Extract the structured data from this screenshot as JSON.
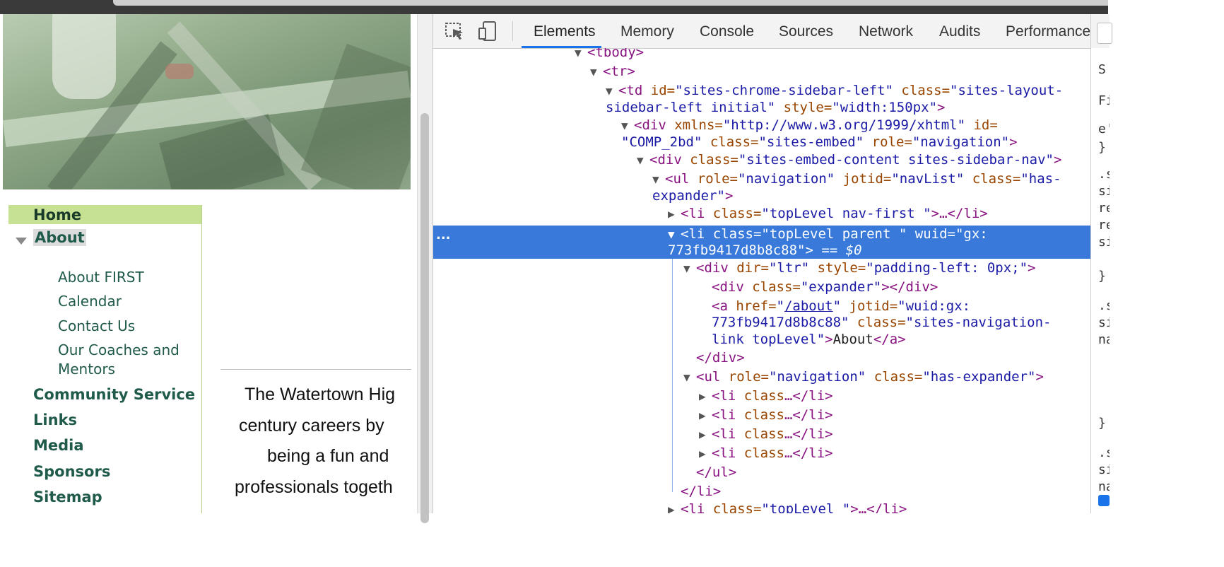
{
  "site": {
    "nav": {
      "home": "Home",
      "about": "About",
      "about_children": [
        "About FIRST",
        "Calendar",
        "Contact Us",
        "Our Coaches and",
        "Mentors"
      ],
      "others": [
        "Community Service",
        "Links",
        "Media",
        "Sponsors",
        "Sitemap"
      ]
    },
    "content_lines": [
      "The Watertown Hig",
      "century careers by",
      "being a fun and",
      "professionals togeth"
    ]
  },
  "devtools": {
    "tabs": [
      "Elements",
      "Memory",
      "Console",
      "Sources",
      "Network",
      "Audits",
      "Performance"
    ],
    "active_tab": "Elements",
    "selected_dots": "...",
    "tree": {
      "l1": "<tbody>",
      "l2": "<tr>",
      "l3a_tag": "<td",
      "l3a_attr1": " id=",
      "l3a_val1": "\"sites-chrome-sidebar-left\"",
      "l3a_attr2": " class=",
      "l3a_val2": "\"sites-layout-",
      "l3b_val": "sidebar-left initial\"",
      "l3b_attr": " style=",
      "l3b_val2": "\"width:150px\"",
      "l3b_end": ">",
      "l4a_tag": "<div",
      "l4a_attr1": " xmlns=",
      "l4a_val1": "\"http://www.w3.org/1999/xhtml\"",
      "l4a_attr2": " id=",
      "l4b_val1": "\"COMP_2bd\"",
      "l4b_attr1": " class=",
      "l4b_val2": "\"sites-embed\"",
      "l4b_attr2": " role=",
      "l4b_val3": "\"navigation\"",
      "l4b_end": ">",
      "l5_tag": "<div",
      "l5_attr": " class=",
      "l5_val": "\"sites-embed-content sites-sidebar-nav\"",
      "l5_end": ">",
      "l6a_tag": "<ul",
      "l6a_attr1": " role=",
      "l6a_val1": "\"navigation\"",
      "l6a_attr2": " jotid=",
      "l6a_val2": "\"navList\"",
      "l6a_attr3": " class=",
      "l6a_val3": "\"has-",
      "l6b_val": "expander\"",
      "l6b_end": ">",
      "l7_tag": "<li",
      "l7_attr": " class=",
      "l7_val": "\"topLevel nav-first \"",
      "l7_end": ">…</li>",
      "sel1_tag": "<li",
      "sel1_attr1": " class=",
      "sel1_val1": "\"topLevel parent \"",
      "sel1_attr2": " wuid=",
      "sel1_val2": "\"gx:",
      "sel2_val": "773fb9417d8b8c88\"",
      "sel2_end": ">",
      "sel2_eq": " == $0",
      "l9_tag": "<div",
      "l9_attr1": " dir=",
      "l9_val1": "\"ltr\"",
      "l9_attr2": " style=",
      "l9_val2": "\"padding-left: 0px;\"",
      "l9_end": ">",
      "l10_tag": "<div",
      "l10_attr": " class=",
      "l10_val": "\"expander\"",
      "l10_end": "></div>",
      "l11_tag": "<a",
      "l11_attr1": " href=",
      "l11_q1": "\"",
      "l11_link": "/about",
      "l11_q2": "\"",
      "l11_attr2": " jotid=",
      "l11_val2": "\"wuid:gx:",
      "l12_val": "773fb9417d8b8c88\"",
      "l12_attr": " class=",
      "l12_val2": "\"sites-navigation-",
      "l13_val": "link topLevel\"",
      "l13_gt": ">",
      "l13_text": "About",
      "l13_end": "</a>",
      "l14": "</div>",
      "l15_tag": "<ul",
      "l15_attr1": " role=",
      "l15_val1": "\"navigation\"",
      "l15_attr2": " class=",
      "l15_val2": "\"has-expander\"",
      "l15_end": ">",
      "li_collapsed_tag": "<li",
      "li_collapsed_attr": " class",
      "li_collapsed_end": "…</li>",
      "l20": "</ul>",
      "l21": "</li>",
      "l22_tag": "<li",
      "l22_attr": " class=",
      "l22_val": "\"topLevel \"",
      "l22_end": ">…</li>"
    },
    "styles_pane": [
      "S",
      "Fi",
      "e'",
      "}",
      ".s",
      "si",
      "re",
      "re",
      "si",
      "}",
      ".s",
      "si",
      "na",
      "}",
      ".s",
      "si",
      "na"
    ]
  },
  "colors": {
    "selection": "#3879d9",
    "nav_home_bg": "#c6e094",
    "nav_text": "#1f5a4a",
    "tab_underline": "#1a73e8"
  }
}
